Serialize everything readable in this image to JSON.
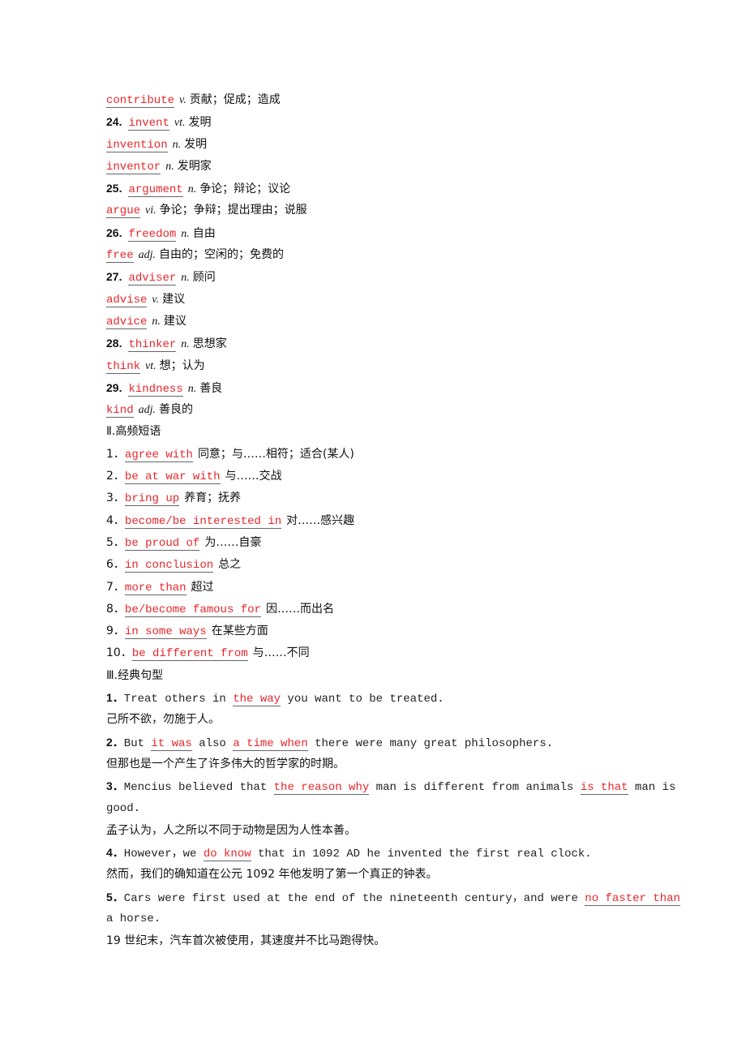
{
  "vocab": [
    {
      "num": "",
      "word": "contribute",
      "pos": "v.",
      "meaning": "贡献；促成；造成"
    },
    {
      "num": "24.",
      "word": "invent",
      "pos": "vt.",
      "meaning": "发明"
    },
    {
      "num": "",
      "word": "invention",
      "pos": "n.",
      "meaning": "发明"
    },
    {
      "num": "",
      "word": "inventor",
      "pos": "n.",
      "meaning": "发明家"
    },
    {
      "num": "25.",
      "word": "argument",
      "pos": "n.",
      "meaning": "争论；辩论；议论"
    },
    {
      "num": "",
      "word": "argue",
      "pos": "vi.",
      "meaning": "争论；争辩；提出理由；说服"
    },
    {
      "num": "26.",
      "word": "freedom",
      "pos": "n.",
      "meaning": "自由"
    },
    {
      "num": "",
      "word": "free",
      "pos": "adj.",
      "meaning": "自由的；空闲的；免费的"
    },
    {
      "num": "27.",
      "word": "adviser",
      "pos": "n.",
      "meaning": "顾问"
    },
    {
      "num": "",
      "word": "advise",
      "pos": "v.",
      "meaning": "建议"
    },
    {
      "num": "",
      "word": "advice",
      "pos": "n.",
      "meaning": "建议"
    },
    {
      "num": "28.",
      "word": "thinker",
      "pos": "n.",
      "meaning": "思想家"
    },
    {
      "num": "",
      "word": "think",
      "pos": "vt.",
      "meaning": "想；认为"
    },
    {
      "num": "29.",
      "word": "kindness",
      "pos": "n.",
      "meaning": "善良"
    },
    {
      "num": "",
      "word": "kind",
      "pos": "adj.",
      "meaning": "善良的"
    }
  ],
  "section2": {
    "title": "Ⅱ.高频短语",
    "items": [
      {
        "num": "1．",
        "phrase": "agree with",
        "meaning": "同意；与……相符；适合(某人)"
      },
      {
        "num": "2．",
        "phrase": "be at war with",
        "meaning": "与……交战"
      },
      {
        "num": "3．",
        "phrase": "bring up",
        "meaning": "养育；抚养"
      },
      {
        "num": "4．",
        "phrase": "become/be interested in",
        "meaning": "对……感兴趣"
      },
      {
        "num": "5．",
        "phrase": "be proud of",
        "meaning": "为……自豪"
      },
      {
        "num": "6．",
        "phrase": "in conclusion",
        "meaning": "总之"
      },
      {
        "num": "7．",
        "phrase": "more than",
        "meaning": "超过"
      },
      {
        "num": "8．",
        "phrase": "be/become famous for",
        "meaning": "因……而出名"
      },
      {
        "num": "9．",
        "phrase": "in some ways",
        "meaning": "在某些方面"
      },
      {
        "num": "10．",
        "phrase": "be different from",
        "meaning": "与……不同"
      }
    ]
  },
  "section3": {
    "title": "Ⅲ.经典句型",
    "s1": {
      "num": "1．",
      "a": "Treat others in ",
      "b1": "the way",
      "c": " you want to be treated.",
      "zh": "己所不欲，勿施于人。"
    },
    "s2": {
      "num": "2．",
      "a": "But ",
      "b1": "it was",
      "c": " also ",
      "b2": "a time when",
      "d": " there were many great philosophers.",
      "zh": "但那也是一个产生了许多伟大的哲学家的时期。"
    },
    "s3": {
      "num": "3．",
      "a": "Mencius believed that ",
      "b1": "the reason why",
      "c": " man is different from animals ",
      "b2": "is that",
      "d": " man is",
      "cont": "good.",
      "zh": "孟子认为，人之所以不同于动物是因为人性本善。"
    },
    "s4": {
      "num": "4．",
      "a": "However，we ",
      "b1": "do know",
      "c": " that in 1092 AD he invented the first real clock.",
      "zh": "然而，我们的确知道在公元 1092 年他发明了第一个真正的钟表。"
    },
    "s5": {
      "num": "5．",
      "a": "Cars were first used at the end of the nineteenth century，and were ",
      "b1": "no faster than",
      "cont": "a horse.",
      "zh": "19 世纪末，汽车首次被使用，其速度并不比马跑得快。"
    }
  }
}
